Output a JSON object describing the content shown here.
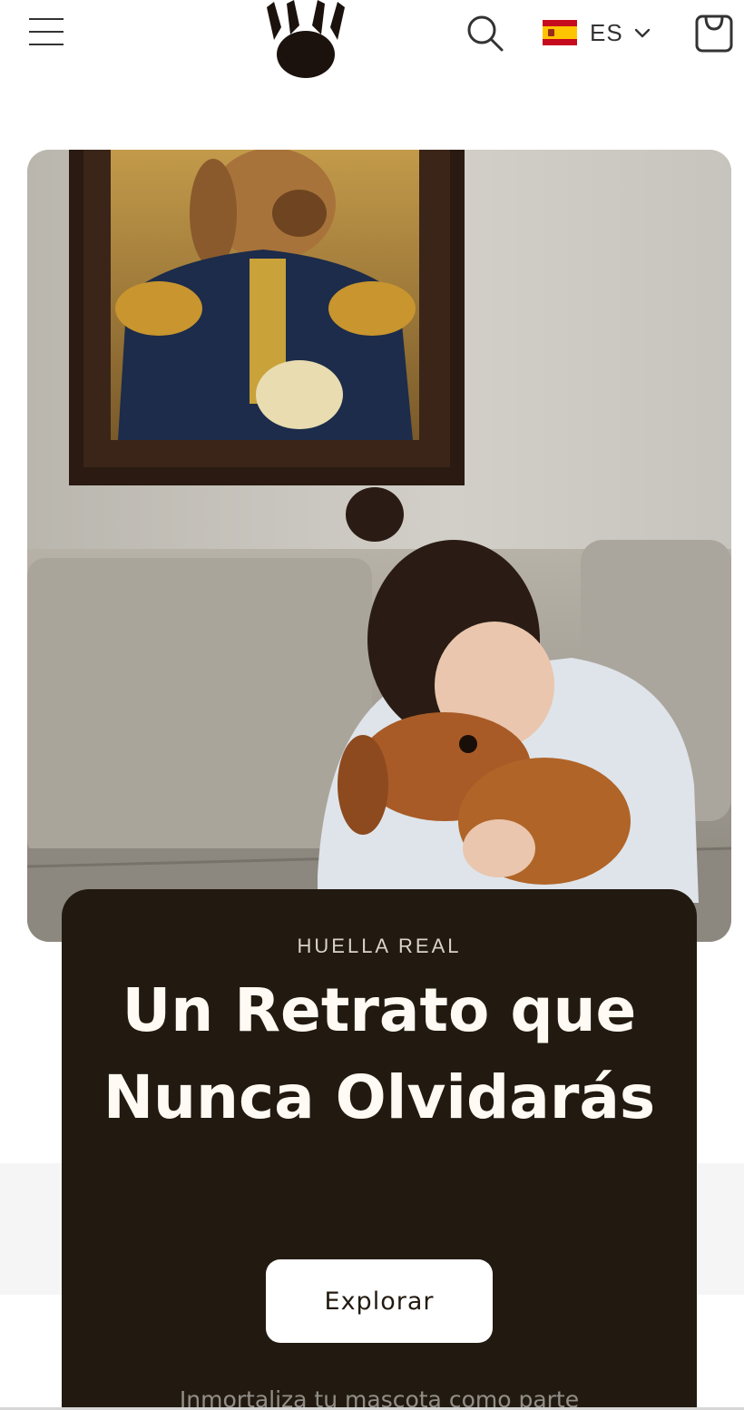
{
  "header": {
    "menu_icon": "hamburger-menu-icon",
    "logo_icon": "paw-print-icon",
    "search_icon": "search-icon",
    "language": {
      "code": "ES",
      "flag_icon": "spain-flag-icon",
      "chevron_icon": "chevron-down-icon"
    },
    "cart_icon": "shopping-bag-icon"
  },
  "hero": {
    "image_icon": "hero-photo-woman-hugging-dog-with-royal-dog-portrait"
  },
  "banner": {
    "eyebrow": "HUELLA REAL",
    "headline": "Un Retrato que Nunca Olvidarás",
    "cta_label": "Explorar",
    "subtext": "Inmortaliza tu mascota como parte"
  },
  "colors": {
    "card_background": "#221a10",
    "button_background": "#ffffff",
    "accent_text": "#fffaf3"
  }
}
